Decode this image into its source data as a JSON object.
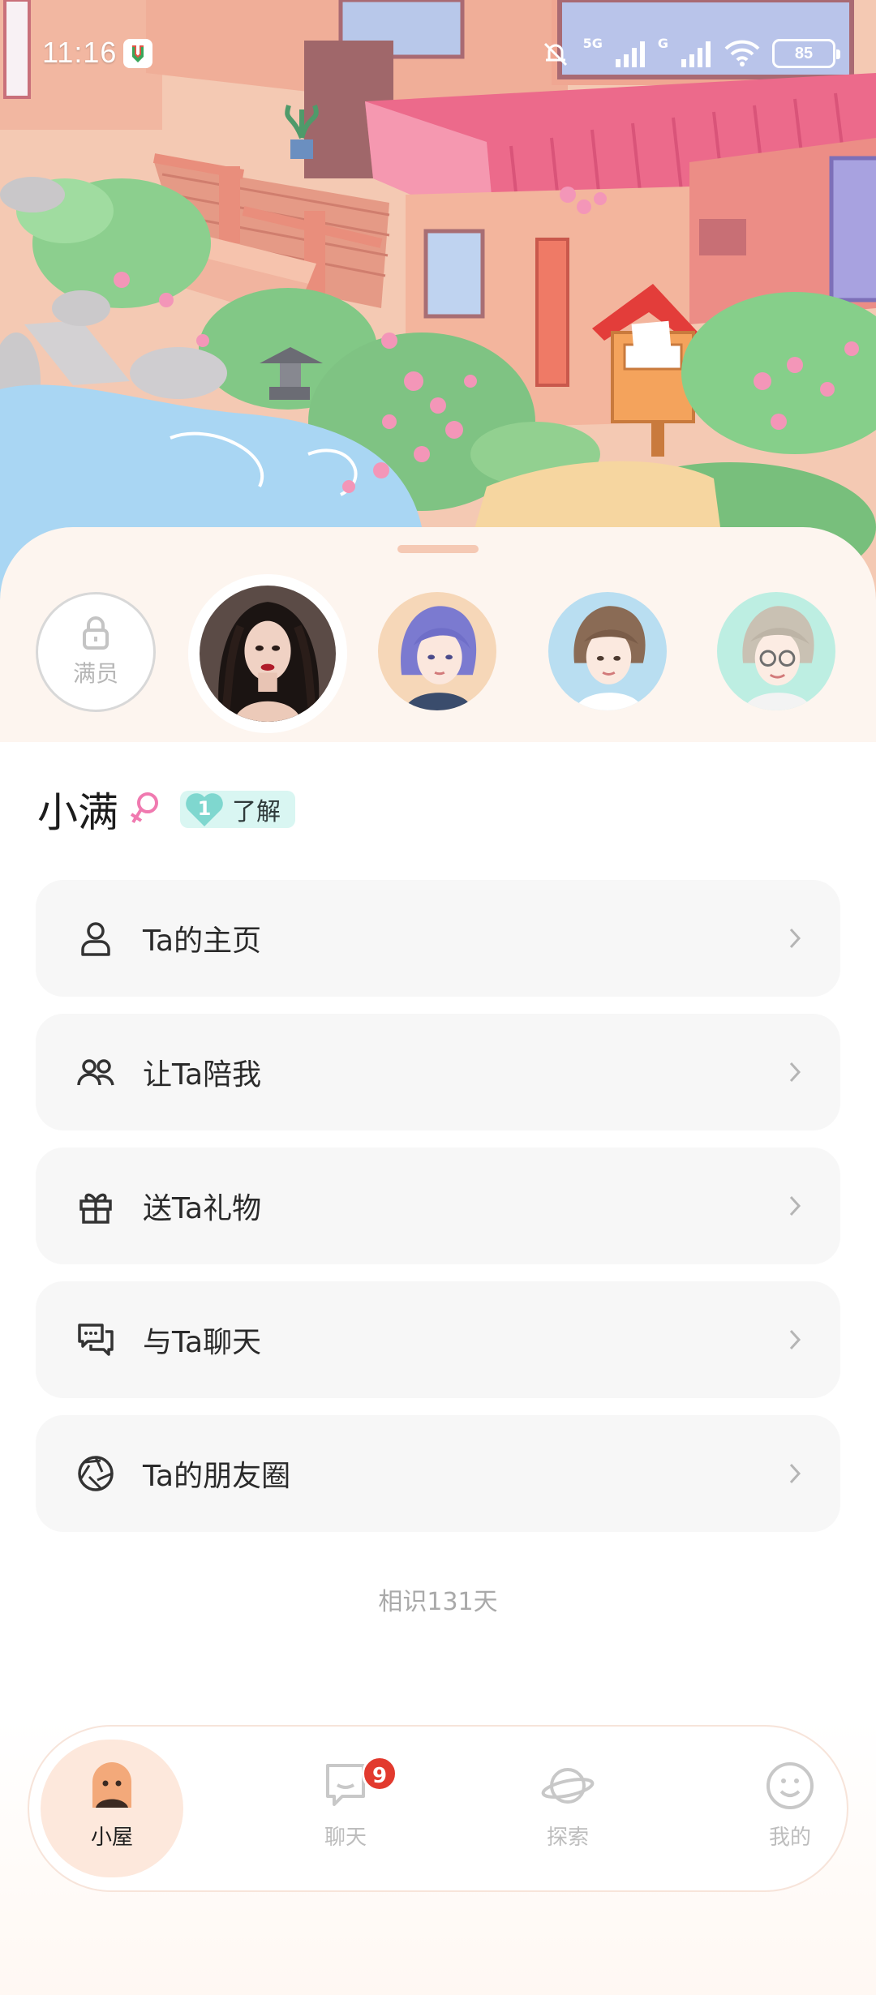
{
  "status_bar": {
    "time": "11:16",
    "network_label": "5G",
    "network_label_2": "G",
    "battery": "85"
  },
  "avatars": {
    "locked_label": "满员",
    "selected_index": 1
  },
  "profile": {
    "name": "小满",
    "gender": "female",
    "level": "1",
    "level_label": "了解"
  },
  "menu": {
    "items": [
      {
        "label": "Ta的主页",
        "icon": "person-icon"
      },
      {
        "label": "让Ta陪我",
        "icon": "people-icon"
      },
      {
        "label": "送Ta礼物",
        "icon": "gift-icon"
      },
      {
        "label": "与Ta聊天",
        "icon": "chat-bubbles-icon"
      },
      {
        "label": "Ta的朋友圈",
        "icon": "aperture-icon"
      }
    ]
  },
  "acquaintance": "相识131天",
  "bottom_nav": {
    "tabs": [
      {
        "label": "小屋",
        "icon": "house-face-icon",
        "active": true
      },
      {
        "label": "聊天",
        "icon": "chat-icon",
        "badge": "9"
      },
      {
        "label": "探索",
        "icon": "planet-icon"
      },
      {
        "label": "我的",
        "icon": "smile-icon"
      }
    ]
  },
  "colors": {
    "accent_pink": "#f07ab0",
    "badge_red": "#e23a2e",
    "level_teal": "#7fd7cf",
    "panel_bg": "#fdf5ef"
  }
}
